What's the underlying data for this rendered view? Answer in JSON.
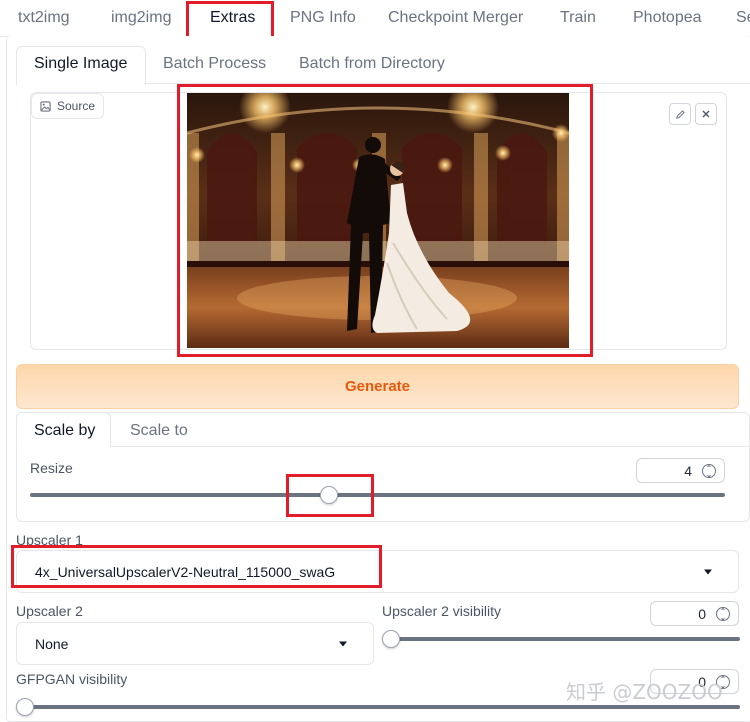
{
  "nav": {
    "tabs": [
      "txt2img",
      "img2img",
      "Extras",
      "PNG Info",
      "Checkpoint Merger",
      "Train",
      "Photopea",
      "Se"
    ],
    "active": "Extras"
  },
  "mode_tabs": [
    "Single Image",
    "Batch Process",
    "Batch from Directory"
  ],
  "source": {
    "label": "Source",
    "edit_icon": "pencil-icon",
    "close_icon": "close-icon"
  },
  "generate_label": "Generate",
  "scale_tabs": [
    "Scale by",
    "Scale to"
  ],
  "resize": {
    "label": "Resize",
    "value": "4",
    "slider_fraction": 0.43
  },
  "upscaler1": {
    "label": "Upscaler 1",
    "value": "4x_UniversalUpscalerV2-Neutral_115000_swaG"
  },
  "upscaler2": {
    "label": "Upscaler 2",
    "value": "None"
  },
  "upscaler2_visibility": {
    "label": "Upscaler 2 visibility",
    "value": "0",
    "slider_fraction": 0
  },
  "gfpgan": {
    "label": "GFPGAN visibility",
    "value": "0",
    "slider_fraction": 0
  },
  "watermark": "知乎 @ZOOZOO",
  "colors": {
    "accent": "#e11d2b",
    "generate_text": "#ea580c",
    "generate_bg": "#fed7aa"
  }
}
